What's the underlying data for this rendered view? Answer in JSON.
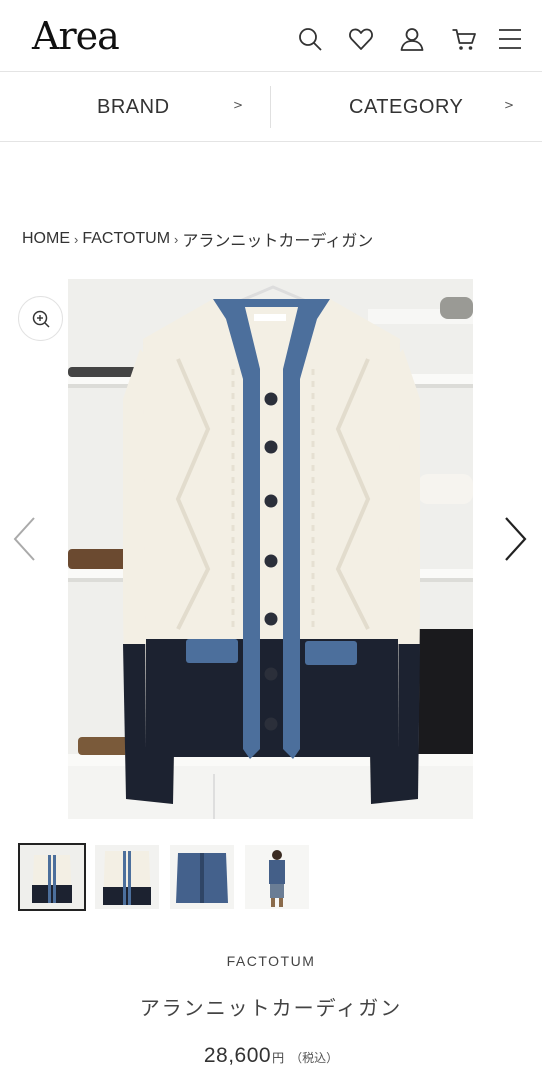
{
  "header": {
    "logo": "Area",
    "icons": [
      "search-icon",
      "heart-icon",
      "user-icon",
      "cart-icon",
      "menu-icon"
    ]
  },
  "nav": {
    "brand_label": "BRAND",
    "brand_arrow": ">",
    "category_label": "CATEGORY",
    "category_arrow": ">"
  },
  "breadcrumb": {
    "items": [
      "HOME",
      "FACTOTUM",
      "アランニットカーディガン"
    ],
    "separator": "›"
  },
  "gallery": {
    "thumbnails": 4,
    "active_index": 0
  },
  "product": {
    "brand": "FACTOTUM",
    "title": "アランニットカーディガン",
    "price": "28,600",
    "currency": "円",
    "tax_note": "（税込）"
  },
  "colors": {
    "cream": "#f3efe4",
    "navy": "#1c2230",
    "blue_trim": "#4c6f9c",
    "text": "#333333",
    "divider": "#e4e4e4"
  }
}
